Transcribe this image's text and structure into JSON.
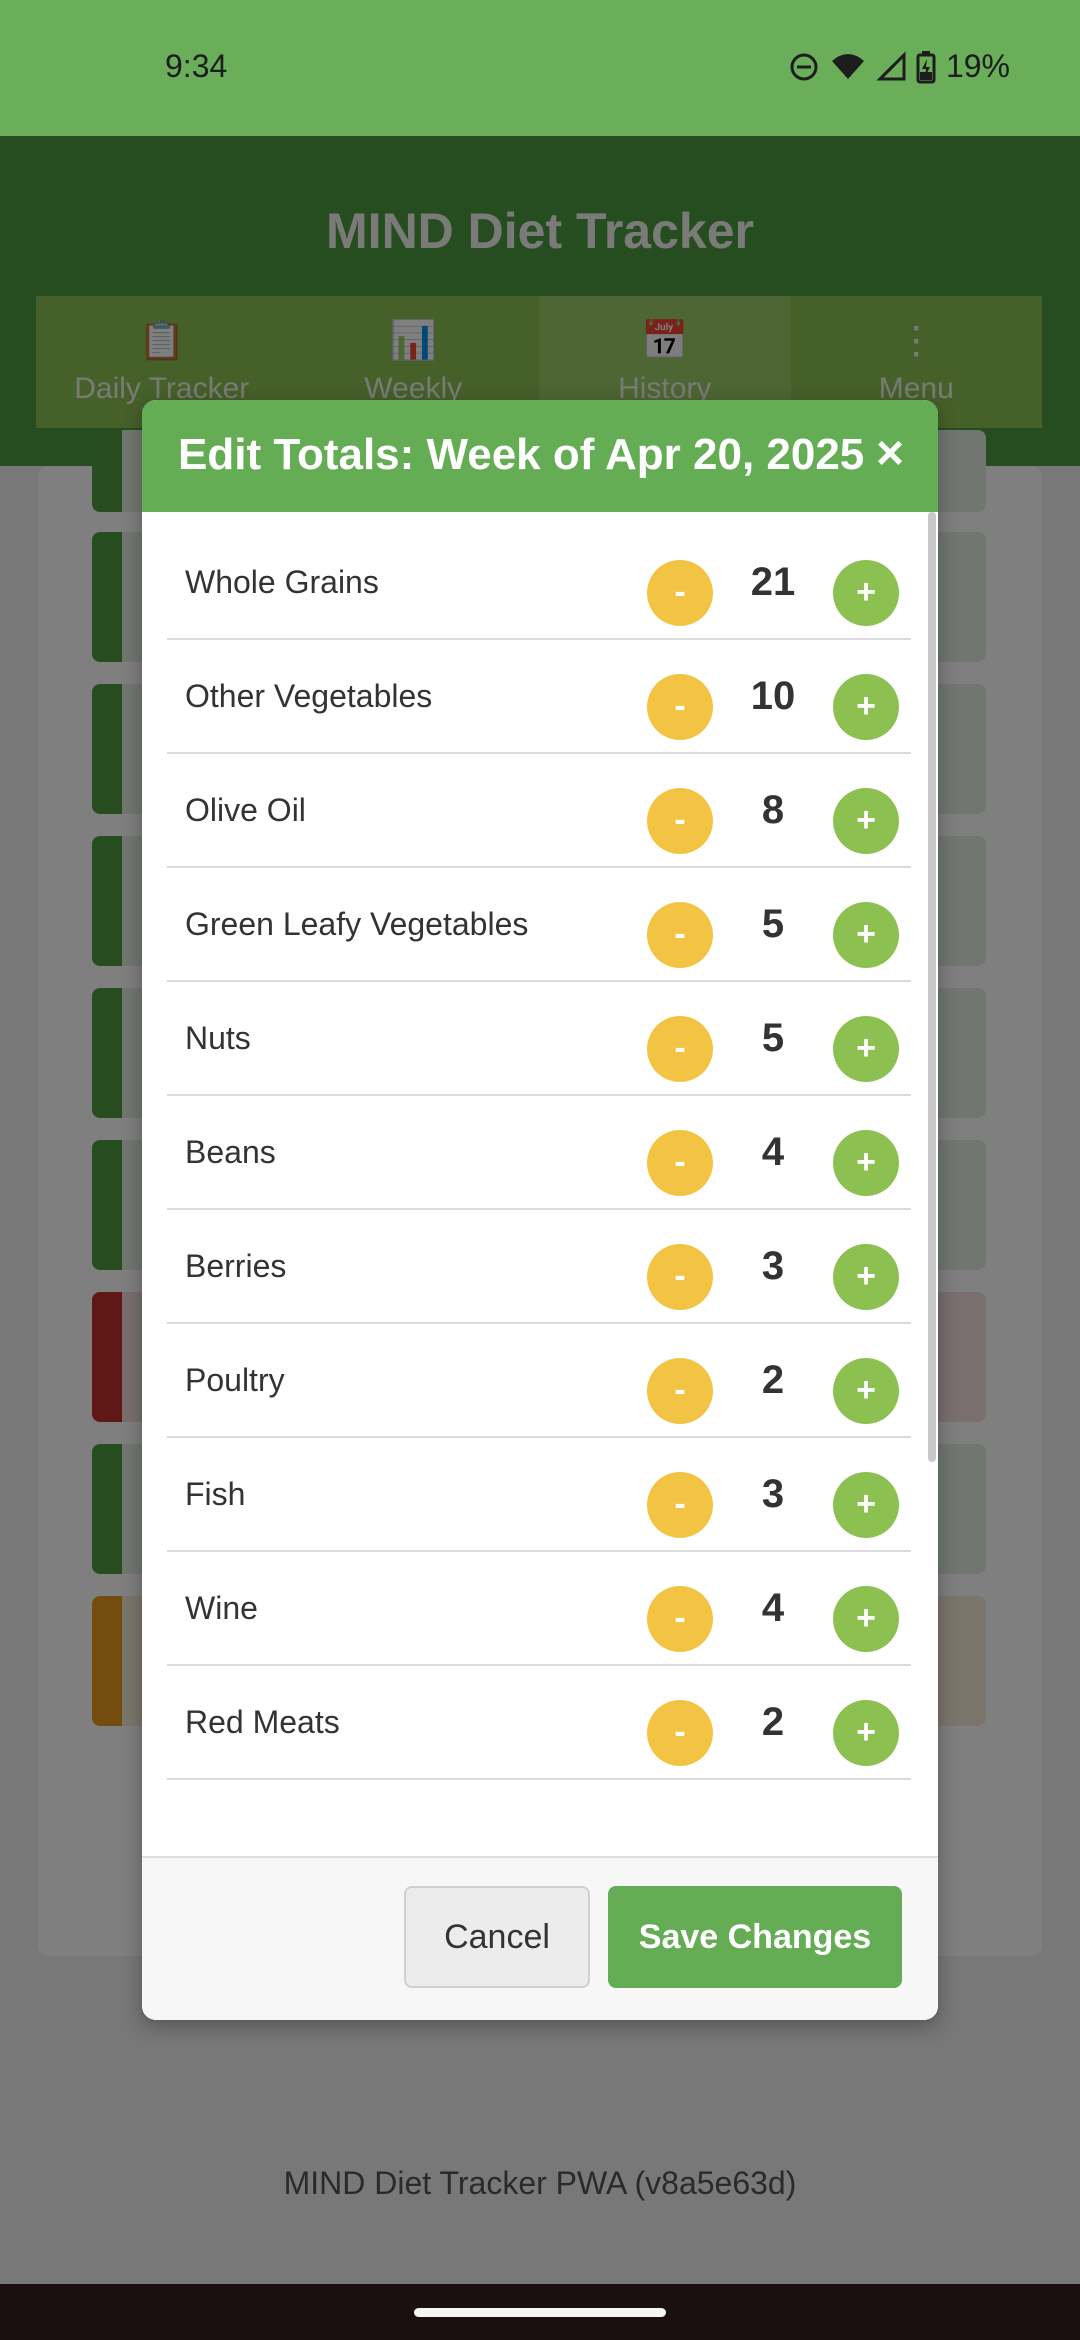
{
  "status_bar": {
    "time": "9:34",
    "battery_percent": "19%",
    "icons": [
      "do-not-disturb-icon",
      "wifi-icon",
      "cell-signal-icon",
      "battery-charging-icon"
    ]
  },
  "app": {
    "title": "MIND Diet Tracker",
    "tabs": [
      {
        "label": "Daily Tracker",
        "icon": "clipboard-icon"
      },
      {
        "label": "Weekly",
        "icon": "bar-chart-icon"
      },
      {
        "label": "History",
        "icon": "calendar-icon",
        "active": true
      },
      {
        "label": "Menu",
        "icon": "more-vertical-icon"
      }
    ],
    "footer": "MIND Diet Tracker PWA (v8a5e63d)"
  },
  "colors": {
    "accent_green": "#65ad55",
    "minus_yellow": "#f3c443",
    "plus_green": "#8cc152"
  },
  "modal": {
    "title": "Edit Totals: Week of Apr 20, 2025",
    "close_label": "×",
    "decrement_label": "-",
    "increment_label": "+",
    "items": [
      {
        "name": "Whole Grains",
        "value": "21"
      },
      {
        "name": "Other Vegetables",
        "value": "10"
      },
      {
        "name": "Olive Oil",
        "value": "8"
      },
      {
        "name": "Green Leafy Vegetables",
        "value": "5"
      },
      {
        "name": "Nuts",
        "value": "5"
      },
      {
        "name": "Beans",
        "value": "4"
      },
      {
        "name": "Berries",
        "value": "3"
      },
      {
        "name": "Poultry",
        "value": "2"
      },
      {
        "name": "Fish",
        "value": "3"
      },
      {
        "name": "Wine",
        "value": "4"
      },
      {
        "name": "Red Meats",
        "value": "2"
      }
    ],
    "cancel_label": "Cancel",
    "save_label": "Save Changes"
  }
}
